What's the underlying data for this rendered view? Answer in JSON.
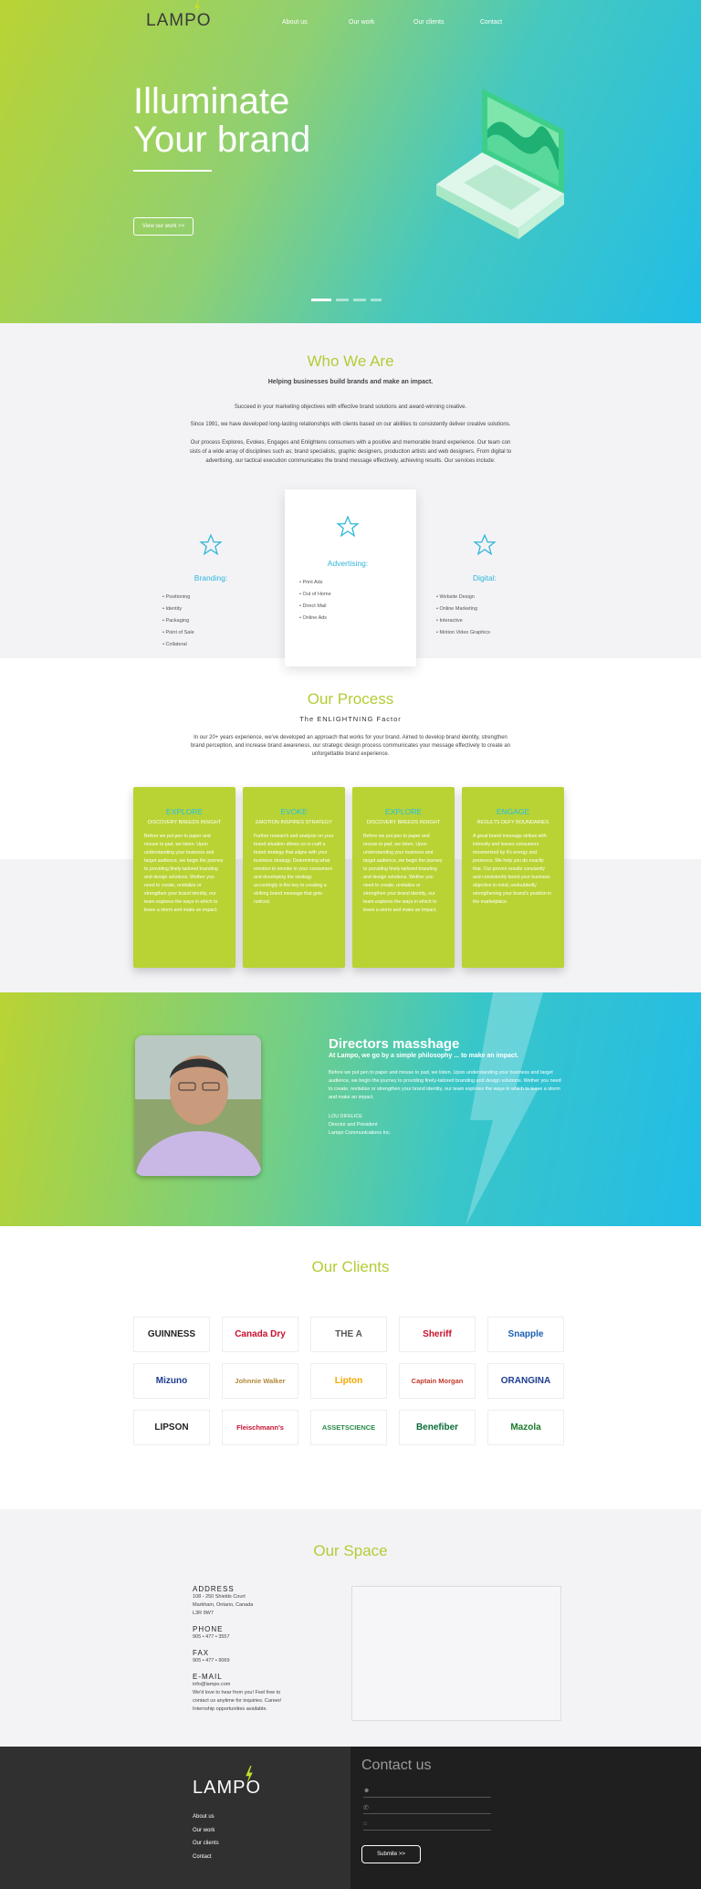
{
  "brand": {
    "logo": "LAMPO"
  },
  "nav": [
    "About us",
    "Our work",
    "Our clients",
    "Contact"
  ],
  "hero": {
    "line1": "Illuminate",
    "line2": "Your brand",
    "cta": "View our work >>"
  },
  "who": {
    "title": "Who We Are",
    "subtitle": "Helping businesses build brands and make an impact.",
    "p1": "Succeed in your marketing objectives with effective brand solutions and award-winning creative.",
    "p2": "Since 1991, we have developed long-lasting relationships with clients based on our abilities to consistently deliver creative solutions.",
    "p3a": "Our process Explores, Evokes, Engages and Enlightens consumers with a positive and memorable brand experience. Our team con",
    "p3b": "sists of a wide array of disciplines such as; brand specialists, graphic designers, production artists and web designers. From digital to",
    "p3c": "advertising, our tactical execution communicates the brand message effectively, achieving results. Our services include:"
  },
  "services": [
    {
      "title": "Branding:",
      "items": [
        "Positioning",
        "Identity",
        "Packaging",
        "Point of Sale",
        "Collateral"
      ]
    },
    {
      "title": "Advertising:",
      "items": [
        "Print Ads",
        "Out of Home",
        "Direct Mail",
        "Online Ads"
      ]
    },
    {
      "title": "Digital:",
      "items": [
        "Website Design",
        "Online Marketing",
        "Interactive",
        "Motion Video Graphics"
      ]
    }
  ],
  "process": {
    "title": "Our Process",
    "subtitle": "The ENLIGHTNING Factor",
    "l1": "In our 20+ years experience, we've developed an approach that works for your brand. Aimed to develop brand identity, strengthen",
    "l2": "brand perception, and increase brand awareness, our strategic design process communicates your message effectively to create an",
    "l3": "unforgettable brand experience.",
    "cards": [
      {
        "t": "EXPLORE",
        "s": "DISCOVERY BREEDS INSIGHT",
        "b": "Before we put pen to paper and mouse to pad, we listen. Upon understanding your business and target audience, we begin the journey to providing finely-tailored branding and design solutions. Wether you need to create, revitalize or strengthen your brand identity, our team explores the ways in which to leave a storm and make an impact."
      },
      {
        "t": "EVOKE",
        "s": "EMOTION INSPIRES STRATEGY",
        "b": "Further research and analysis on your brand situation allows us to craft a brand strategy that aligns with your business strategy. Determining what emotion to envoke in your consumers and developing the strategy accordingly is the key to creating a striking brand message that gets noticed."
      },
      {
        "t": "EXPLORE",
        "s": "DISCOVERY BREEDS INSIGHT",
        "b": "Before we put pen to paper and mouse to pad, we listen. Upon understanding your business and target audience, we begin the journey to providing finely-tailored branding and design solutions. Wether you need to create, revitalize or strengthen your brand identity, our team explores the ways in which to leave a storm and make an impact."
      },
      {
        "t": "ENGAGE",
        "s": "RESULTS DEFY BOUNDARIES",
        "b": "A great brand message strikes with intensity and leaves consumers mesmerized by it's energy and presence. We help you do exactly that. Our proven results constantly and consistently boost your business objective in mind, undoubtedly strengthening your brand's position in the marketplace."
      }
    ]
  },
  "director": {
    "title": "Directors masshage",
    "quote": "At Lampo, we go by a simple philosophy ... to make an impact.",
    "body": "Before we put pen to paper and mouse to pad, we listen. Upon understanding your business and target audience, we begin the journey to providing finely-tailored branding and design solutions. Wether you need to create, revitalize or strengthen your brand identity, our team explores the ways in which to leave a storm and make an impact.",
    "name": "LOU DIFELICE",
    "role": "Director and President",
    "company": "Lampo Communications Inc."
  },
  "clients": {
    "title": "Our Clients",
    "logos": [
      "GUINNESS",
      "Canada Dry",
      "THE A",
      "Sheriff",
      "Snapple",
      "Mizuno",
      "Johnnie Walker",
      "Lipton",
      "Captain Morgan",
      "ORANGINA",
      "LIPSON",
      "Fleischmann's",
      "ASSETSCIENCE",
      "Benefiber",
      "Mazola"
    ],
    "colors": [
      "#222",
      "#c8102e",
      "#555",
      "#c8102e",
      "#1a5fb4",
      "#1b3c8f",
      "#b08a3a",
      "#f2a900",
      "#c23b2b",
      "#1b3c8f",
      "#222",
      "#c8102e",
      "#2a8a4a",
      "#0a6b3a",
      "#1a7a2a"
    ]
  },
  "space": {
    "title": "Our Space",
    "address_label": "ADDRESS",
    "address": [
      "108 - 250 Shields Court",
      "Markham, Ontario, Canada",
      "L3R 9W7"
    ],
    "phone_label": "PHONE",
    "phone": "905 • 477 • 3557",
    "fax_label": "FAX",
    "fax": "905 • 477 • 9069",
    "email_label": "E-MAIL",
    "email": "info@lampo.com",
    "note": [
      "We'd love to hear from you! Feel free to",
      "contact us anytime for inquiries. Career/",
      "Internship opportunities available."
    ]
  },
  "footer": {
    "logo": "LAMPO",
    "links": [
      "About us",
      "Our work",
      "Our clients",
      "Contact"
    ],
    "contact_title": "Contact us",
    "submit": "Submite >>"
  }
}
